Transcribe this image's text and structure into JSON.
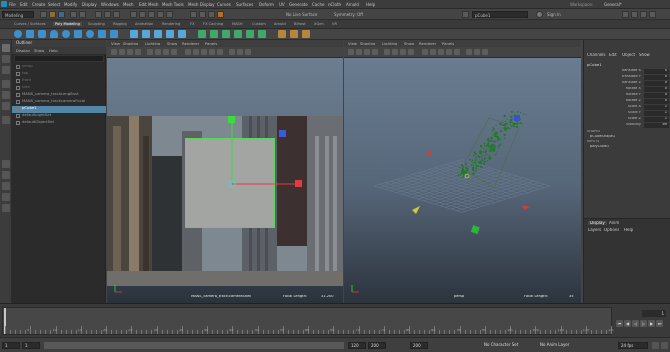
{
  "menubar": {
    "items": [
      "File",
      "Edit",
      "Create",
      "Select",
      "Modify",
      "Display",
      "Windows",
      "Mesh",
      "Edit Mesh",
      "Mesh Tools",
      "Mesh Display",
      "Curves",
      "Surfaces",
      "Deform",
      "UV",
      "Generate",
      "Cache",
      "nCloth",
      "Arnold",
      "Help"
    ],
    "workspace_label": "Workspace:",
    "workspace_value": "General*"
  },
  "statusline": {
    "mode": "Modeling",
    "live_surface": "No Live Surface",
    "symmetry": "Symmetry: Off",
    "object_field": "pCube1",
    "sign_in": "Sign In"
  },
  "shelf": {
    "tabs": [
      "Curves / Surfaces",
      "Poly Modeling",
      "Sculpting",
      "Rigging",
      "Animation",
      "Rendering",
      "FX",
      "FX Caching",
      "MASH",
      "Custom",
      "Arnold",
      "Bifrost",
      "XGen",
      "VR"
    ],
    "active_tab": "Poly Modeling"
  },
  "outliner": {
    "title": "Outliner",
    "menu": [
      "Display",
      "Show",
      "Help"
    ],
    "rows": [
      {
        "label": "persp",
        "selected": false,
        "dim": true
      },
      {
        "label": "top",
        "selected": false,
        "dim": true
      },
      {
        "label": "front",
        "selected": false,
        "dim": true
      },
      {
        "label": "side",
        "selected": false,
        "dim": true
      },
      {
        "label": "MANS_camera_trackLengBust",
        "selected": false,
        "dim": false
      },
      {
        "label": "MANS_camera_trackcameraFocal",
        "selected": false,
        "dim": false
      },
      {
        "label": "pCube1",
        "selected": true,
        "dim": false
      },
      {
        "label": "defaultLightSet",
        "selected": false,
        "dim": false
      },
      {
        "label": "defaultObjectSet",
        "selected": false,
        "dim": false
      }
    ]
  },
  "viewport_left": {
    "menu": [
      "View",
      "Shading",
      "Lighting",
      "Show",
      "Renderer",
      "Panels"
    ],
    "camera_label": "MANS_camera_track:cameraShell",
    "focal_label": "Focal Length:",
    "focal_value": "31.200"
  },
  "viewport_right": {
    "menu": [
      "View",
      "Shading",
      "Lighting",
      "Show",
      "Renderer",
      "Panels"
    ],
    "camera_label": "persp",
    "focal_label": "Focal Length:",
    "focal_value": "35"
  },
  "channelbox": {
    "tabs": [
      "Channels",
      "Edit",
      "Object",
      "Show"
    ],
    "object_name": "pCube1",
    "channels": [
      {
        "name": "Translate X",
        "value": "0"
      },
      {
        "name": "Translate Y",
        "value": "0"
      },
      {
        "name": "Translate Z",
        "value": "0"
      },
      {
        "name": "Rotate X",
        "value": "0"
      },
      {
        "name": "Rotate Y",
        "value": "0"
      },
      {
        "name": "Rotate Z",
        "value": "0"
      },
      {
        "name": "Scale X",
        "value": "1"
      },
      {
        "name": "Scale Y",
        "value": "1"
      },
      {
        "name": "Scale Z",
        "value": "1"
      },
      {
        "name": "Visibility",
        "value": "on"
      }
    ],
    "shapes_label": "SHAPES",
    "shape_name": "pCubeShape1",
    "inputs_label": "INPUTS",
    "input_name": "polyCube1",
    "layer_tabs": [
      "Display",
      "Anim"
    ],
    "layer_menu": [
      "Layers",
      "Options",
      "Help"
    ]
  },
  "timeline": {
    "ticks": [
      "5",
      "10",
      "15",
      "20",
      "25",
      "30",
      "35",
      "40",
      "45",
      "50",
      "55",
      "60",
      "65",
      "70",
      "75",
      "80",
      "85",
      "90",
      "95",
      "100",
      "105",
      "110",
      "115",
      "120"
    ],
    "current_frame": "1"
  },
  "range": {
    "start": "1",
    "inner_start": "1",
    "inner_end": "120",
    "end_a": "200",
    "end_b": "200",
    "char_set": "No Character Set",
    "anim_layer": "No Anim Layer",
    "fps": "24 fps"
  },
  "colors": {
    "selection": "#5285a6",
    "viewport_top": "#6d7f93",
    "viewport_bottom": "#2d3640",
    "grid": "#5d6e80",
    "cube": "#9ea09e",
    "particles": "#1f7a1f"
  }
}
